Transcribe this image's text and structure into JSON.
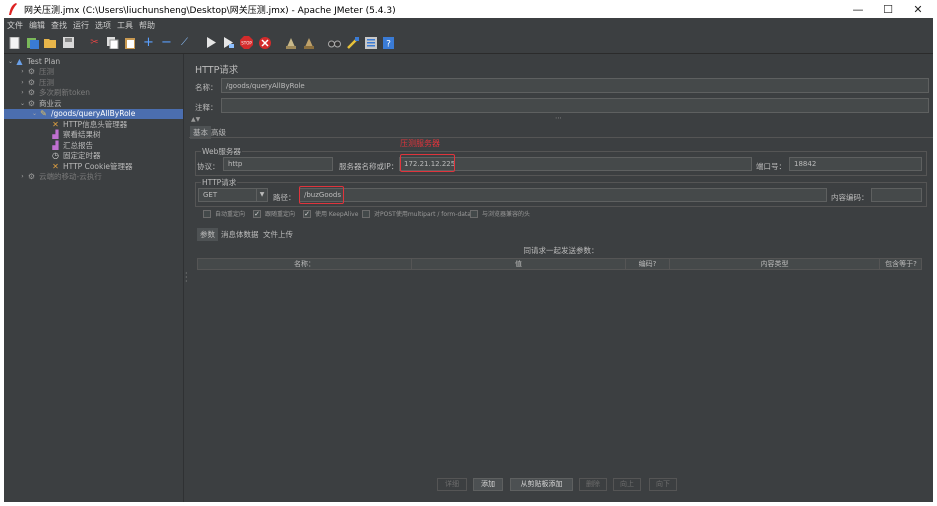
{
  "window": {
    "title": "网关压测.jmx (C:\\Users\\liuchunsheng\\Desktop\\网关压测.jmx) - Apache JMeter (5.4.3)",
    "controls": [
      "—",
      "☐",
      "✕"
    ]
  },
  "menu": [
    "文件",
    "编辑",
    "查找",
    "运行",
    "选项",
    "工具",
    "帮助"
  ],
  "toolbar_icons": [
    "new-icon",
    "templates-icon",
    "open-icon",
    "save-icon",
    "cut-icon",
    "copy-icon",
    "paste-icon",
    "expand-icon",
    "collapse-icon",
    "toggle-icon",
    "start-icon",
    "start-no-pause-icon",
    "stop-icon",
    "shutdown-icon",
    "clear-icon",
    "clear-all-icon",
    "search-icon",
    "reset-search-icon",
    "function-helper-icon",
    "help-icon"
  ],
  "tree": {
    "items": [
      {
        "label": "Test Plan",
        "icon": "testplan-icon",
        "indent": 0,
        "toggle": "v",
        "state": "normal"
      },
      {
        "label": "压测",
        "icon": "thread-group-icon",
        "indent": 1,
        "toggle": ">",
        "state": "dim"
      },
      {
        "label": "压测",
        "icon": "thread-group-icon",
        "indent": 1,
        "toggle": ">",
        "state": "dim"
      },
      {
        "label": "多次刷新token",
        "icon": "thread-group-icon",
        "indent": 1,
        "toggle": ">",
        "state": "dim"
      },
      {
        "label": "商业云",
        "icon": "thread-group-icon",
        "indent": 1,
        "toggle": "v",
        "state": "normal"
      },
      {
        "label": "/goods/queryAllByRole",
        "icon": "sampler-icon",
        "indent": 2,
        "toggle": "v",
        "state": "selected"
      },
      {
        "label": "HTTP信息头管理器",
        "icon": "header-manager-icon",
        "indent": 3,
        "toggle": "",
        "state": "normal"
      },
      {
        "label": "察看结果树",
        "icon": "listener-icon",
        "indent": 3,
        "toggle": "",
        "state": "normal"
      },
      {
        "label": "汇总报告",
        "icon": "listener-icon",
        "indent": 3,
        "toggle": "",
        "state": "normal"
      },
      {
        "label": "固定定时器",
        "icon": "timer-icon",
        "indent": 3,
        "toggle": "",
        "state": "normal"
      },
      {
        "label": "HTTP Cookie管理器",
        "icon": "cookie-manager-icon",
        "indent": 3,
        "toggle": "",
        "state": "normal"
      },
      {
        "label": "云端的移动-云执行",
        "icon": "thread-group-icon",
        "indent": 1,
        "toggle": ">",
        "state": "dim"
      }
    ]
  },
  "panel": {
    "title": "HTTP请求",
    "name_label": "名称：",
    "name_value": "/goods/queryAllByRole",
    "comment_label": "注释：",
    "comment_value": "",
    "tabs": [
      "基本",
      "高级"
    ],
    "web_server_legend": "Web服务器",
    "protocol_label": "协议：",
    "protocol_value": "http",
    "server_label": "服务器名称或IP：",
    "server_value": "172.21.12.225",
    "port_label": "端口号：",
    "port_value": "18842",
    "annotation": "压测服务器",
    "http_request_legend": "HTTP请求",
    "method_value": "GET",
    "path_label": "路径：",
    "path_value": "/buzGoods",
    "encoding_label": "内容编码：",
    "encoding_value": "",
    "checkboxes": [
      {
        "label": "自动重定向",
        "checked": false
      },
      {
        "label": "跟随重定向",
        "checked": true
      },
      {
        "label": "使用 KeepAlive",
        "checked": true
      },
      {
        "label": "对POST使用multipart / form-data",
        "checked": false
      },
      {
        "label": "与浏览器兼容的头",
        "checked": false
      }
    ],
    "sub_tabs": [
      "参数",
      "消息体数据",
      "文件上传"
    ],
    "params_caption": "同请求一起发送参数：",
    "columns": [
      "名称：",
      "值",
      "编码?",
      "内容类型",
      "包含等于?"
    ],
    "buttons": [
      {
        "label": "详细",
        "enabled": false
      },
      {
        "label": "添加",
        "enabled": true
      },
      {
        "label": "从剪贴板添加",
        "enabled": true
      },
      {
        "label": "删除",
        "enabled": false
      },
      {
        "label": "向上",
        "enabled": false
      },
      {
        "label": "向下",
        "enabled": false
      }
    ]
  },
  "colors": {
    "annotation": "#e0343c",
    "selection": "#4b6eaf",
    "background": "#3c3f41"
  }
}
